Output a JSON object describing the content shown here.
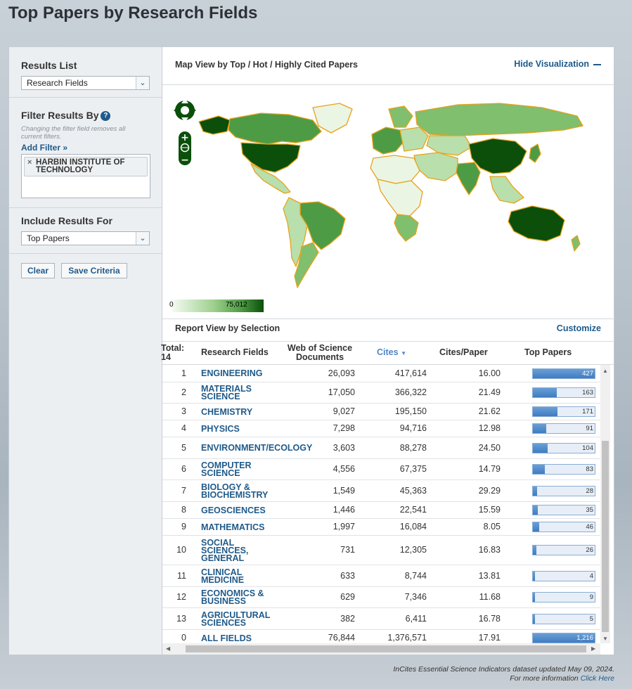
{
  "page": {
    "title": "Top Papers by Research Fields"
  },
  "sidebar": {
    "results_list": {
      "heading": "Results List",
      "selected": "Research Fields"
    },
    "filter": {
      "heading": "Filter Results By",
      "help": "?",
      "note": "Changing the filter field removes all current filters.",
      "add_filter": "Add Filter »",
      "tag_remove": "×",
      "tag": "HARBIN INSTITUTE OF TECHNOLOGY"
    },
    "include": {
      "heading": "Include Results For",
      "selected": "Top Papers"
    },
    "buttons": {
      "clear": "Clear",
      "save": "Save Criteria"
    }
  },
  "map": {
    "title": "Map View by Top / Hot / Highly Cited Papers",
    "hide": "Hide Visualization",
    "legend_min": "0",
    "legend_max": "75,012",
    "colors": {
      "lowest": "#eaf5e4",
      "low": "#b9dfac",
      "mid": "#7fbf6e",
      "high": "#4e9b45",
      "highest": "#0b4f0b",
      "border": "#e8a21a"
    }
  },
  "report": {
    "title": "Report View by Selection",
    "customize": "Customize",
    "headers": {
      "total": "Total:",
      "total_count": "14",
      "field": "Research Fields",
      "docs": "Web of Science Documents",
      "cites": "Cites",
      "cpp": "Cites/Paper",
      "top": "Top Papers"
    },
    "rows": [
      {
        "rank": "1",
        "field": "ENGINEERING",
        "docs": "26,093",
        "cites": "417,614",
        "cpp": "16.00",
        "top": "427",
        "top_value": 427
      },
      {
        "rank": "2",
        "field": "MATERIALS SCIENCE",
        "docs": "17,050",
        "cites": "366,322",
        "cpp": "21.49",
        "top": "163",
        "top_value": 163
      },
      {
        "rank": "3",
        "field": "CHEMISTRY",
        "docs": "9,027",
        "cites": "195,150",
        "cpp": "21.62",
        "top": "171",
        "top_value": 171
      },
      {
        "rank": "4",
        "field": "PHYSICS",
        "docs": "7,298",
        "cites": "94,716",
        "cpp": "12.98",
        "top": "91",
        "top_value": 91
      },
      {
        "rank": "5",
        "field": "ENVIRONMENT/ECOLOGY",
        "docs": "3,603",
        "cites": "88,278",
        "cpp": "24.50",
        "top": "104",
        "top_value": 104
      },
      {
        "rank": "6",
        "field": "COMPUTER SCIENCE",
        "docs": "4,556",
        "cites": "67,375",
        "cpp": "14.79",
        "top": "83",
        "top_value": 83
      },
      {
        "rank": "7",
        "field": "BIOLOGY & BIOCHEMISTRY",
        "docs": "1,549",
        "cites": "45,363",
        "cpp": "29.29",
        "top": "28",
        "top_value": 28
      },
      {
        "rank": "8",
        "field": "GEOSCIENCES",
        "docs": "1,446",
        "cites": "22,541",
        "cpp": "15.59",
        "top": "35",
        "top_value": 35
      },
      {
        "rank": "9",
        "field": "MATHEMATICS",
        "docs": "1,997",
        "cites": "16,084",
        "cpp": "8.05",
        "top": "46",
        "top_value": 46
      },
      {
        "rank": "10",
        "field": "SOCIAL SCIENCES, GENERAL",
        "docs": "731",
        "cites": "12,305",
        "cpp": "16.83",
        "top": "26",
        "top_value": 26
      },
      {
        "rank": "11",
        "field": "CLINICAL MEDICINE",
        "docs": "633",
        "cites": "8,744",
        "cpp": "13.81",
        "top": "4",
        "top_value": 4
      },
      {
        "rank": "12",
        "field": "ECONOMICS & BUSINESS",
        "docs": "629",
        "cites": "7,346",
        "cpp": "11.68",
        "top": "9",
        "top_value": 9
      },
      {
        "rank": "13",
        "field": "AGRICULTURAL SCIENCES",
        "docs": "382",
        "cites": "6,411",
        "cpp": "16.78",
        "top": "5",
        "top_value": 5
      },
      {
        "rank": "0",
        "field": "ALL FIELDS",
        "docs": "76,844",
        "cites": "1,376,571",
        "cpp": "17.91",
        "top": "1,216",
        "top_value": 1216
      }
    ]
  },
  "footer": {
    "line1": "InCites Essential Science Indicators dataset updated May 09, 2024.",
    "line2_prefix": "For more information",
    "line2_link": "Click Here"
  }
}
